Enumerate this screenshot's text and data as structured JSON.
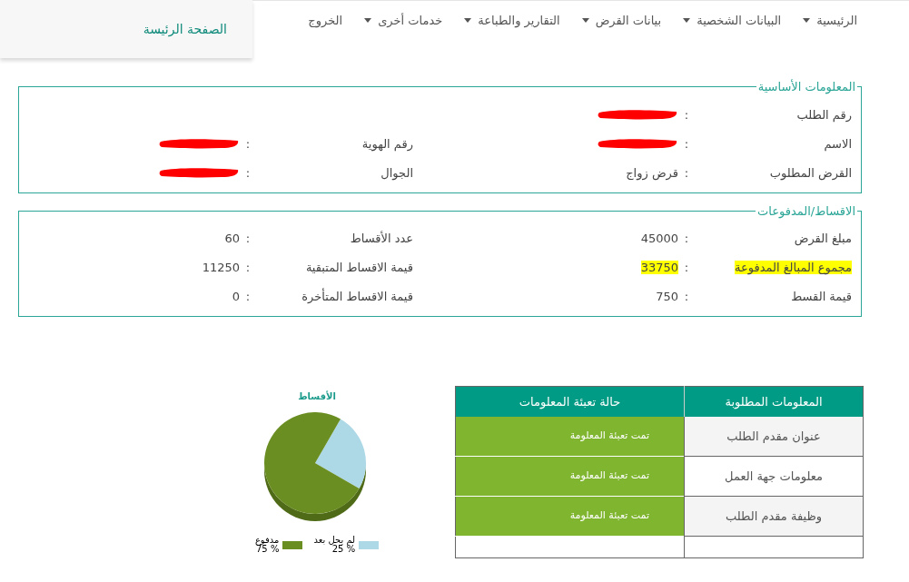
{
  "nav": {
    "items": [
      {
        "label": "الرئيسية",
        "caret": true
      },
      {
        "label": "البيانات الشخصية",
        "caret": true
      },
      {
        "label": "بيانات القرض",
        "caret": true
      },
      {
        "label": "التقارير والطباعة",
        "caret": true
      },
      {
        "label": "خدمات أخرى",
        "caret": true
      },
      {
        "label": "الخروج",
        "caret": false
      }
    ],
    "home_tab": "الصفحة الرئيسة"
  },
  "sections": [
    {
      "legend": "المعلومات الأساسية",
      "rows": [
        {
          "pairs": [
            {
              "label": "رقم الطلب",
              "separator": ":",
              "kind": "redacted",
              "highlighted": false
            }
          ]
        },
        {
          "pairs": [
            {
              "label": "الاسم",
              "separator": ":",
              "kind": "redacted",
              "highlighted": false
            },
            {
              "label": "رقم الهوية",
              "separator": ":",
              "kind": "redacted",
              "highlighted": false
            }
          ]
        },
        {
          "pairs": [
            {
              "label": "القرض المطلوب",
              "separator": ":",
              "kind": "text",
              "value": "قرض زواج",
              "highlighted": false
            },
            {
              "label": "الجوال",
              "separator": ":",
              "kind": "redacted",
              "highlighted": false
            }
          ]
        }
      ]
    },
    {
      "legend": "الاقساط/المدفوعات",
      "rows": [
        {
          "pairs": [
            {
              "label": "مبلغ القرض",
              "separator": ":",
              "kind": "text",
              "value": "45000",
              "highlighted": false
            },
            {
              "label": "عدد الأقساط",
              "separator": ":",
              "kind": "text",
              "value": "60",
              "highlighted": false
            }
          ]
        },
        {
          "pairs": [
            {
              "label": "مجموع المبالغ المدفوعة",
              "separator": ":",
              "kind": "text",
              "value": "33750",
              "highlighted": true
            },
            {
              "label": "قيمة الاقساط المتبقية",
              "separator": ":",
              "kind": "text",
              "value": "11250",
              "highlighted": false
            }
          ]
        },
        {
          "pairs": [
            {
              "label": "قيمة القسط",
              "separator": ":",
              "kind": "text",
              "value": "750",
              "highlighted": false
            },
            {
              "label": "قيمة الاقساط المتأخرة",
              "separator": ":",
              "kind": "text",
              "value": "0",
              "highlighted": false
            }
          ]
        }
      ]
    }
  ],
  "status_table": {
    "columns": [
      "المعلومات المطلوبة",
      "حالة تعبئة المعلومات"
    ],
    "rows": [
      {
        "item": "عنوان مقدم الطلب",
        "status": "تمت تعبئة المعلومة"
      },
      {
        "item": "معلومات جهة العمل",
        "status": "تمت تعبئة المعلومة"
      },
      {
        "item": "وظيفة مقدم الطلب",
        "status": "تمت تعبئة المعلومة"
      }
    ]
  },
  "chart": {
    "chart_data": {
      "type": "pie",
      "title": "الأقساط",
      "categories": [
        "لم يحل بعد",
        "مدفوع"
      ],
      "series": [
        {
          "values": [
            25,
            75
          ]
        }
      ],
      "colors": [
        "#add8e6",
        "#6b8e23"
      ],
      "value_labels": [
        "% 25",
        "% 75"
      ]
    }
  }
}
